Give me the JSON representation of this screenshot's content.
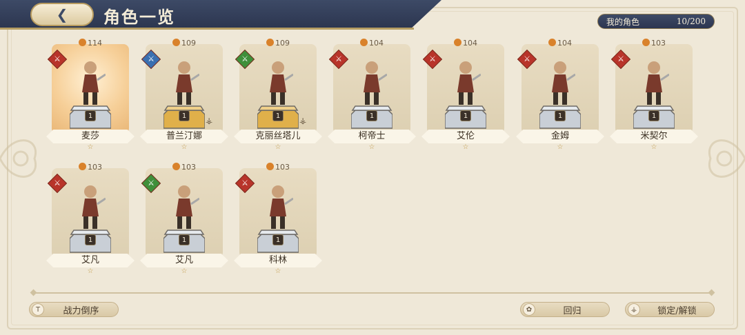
{
  "header": {
    "title": "角色一览",
    "back_icon": "back-arrow-icon"
  },
  "roster": {
    "label": "我的角色",
    "count": "10/200"
  },
  "colors": {
    "header_navy": "#2c3650",
    "parchment": "#efe8d8",
    "highlight": "#f6cf98"
  },
  "characters": [
    {
      "name": "麦莎",
      "power": "114",
      "level": "1",
      "stars": "☆",
      "class_color": "#b8342a",
      "locked": false,
      "highlight": true
    },
    {
      "name": "普兰汀娜",
      "power": "109",
      "level": "1",
      "stars": "☆",
      "class_color": "#3a6fb0",
      "locked": true,
      "highlight": false
    },
    {
      "name": "克丽丝塔儿",
      "power": "109",
      "level": "1",
      "stars": "☆",
      "class_color": "#3f8f3a",
      "locked": true,
      "highlight": false
    },
    {
      "name": "柯帝士",
      "power": "104",
      "level": "1",
      "stars": "☆",
      "class_color": "#b8342a",
      "locked": false,
      "highlight": false
    },
    {
      "name": "艾伦",
      "power": "104",
      "level": "1",
      "stars": "☆",
      "class_color": "#b8342a",
      "locked": false,
      "highlight": false
    },
    {
      "name": "金姆",
      "power": "104",
      "level": "1",
      "stars": "☆",
      "class_color": "#b8342a",
      "locked": false,
      "highlight": false
    },
    {
      "name": "米契尔",
      "power": "103",
      "level": "1",
      "stars": "☆",
      "class_color": "#b8342a",
      "locked": false,
      "highlight": false
    },
    {
      "name": "艾凡",
      "power": "103",
      "level": "1",
      "stars": "☆",
      "class_color": "#b8342a",
      "locked": false,
      "highlight": false
    },
    {
      "name": "艾凡",
      "power": "103",
      "level": "1",
      "stars": "☆",
      "class_color": "#3f8f3a",
      "locked": false,
      "highlight": false
    },
    {
      "name": "科林",
      "power": "103",
      "level": "1",
      "stars": "☆",
      "class_color": "#b8342a",
      "locked": false,
      "highlight": false
    }
  ],
  "footer": {
    "sort_label": "战力倒序",
    "sort_icon": "T",
    "return_label": "回归",
    "lock_label": "锁定/解锁"
  }
}
